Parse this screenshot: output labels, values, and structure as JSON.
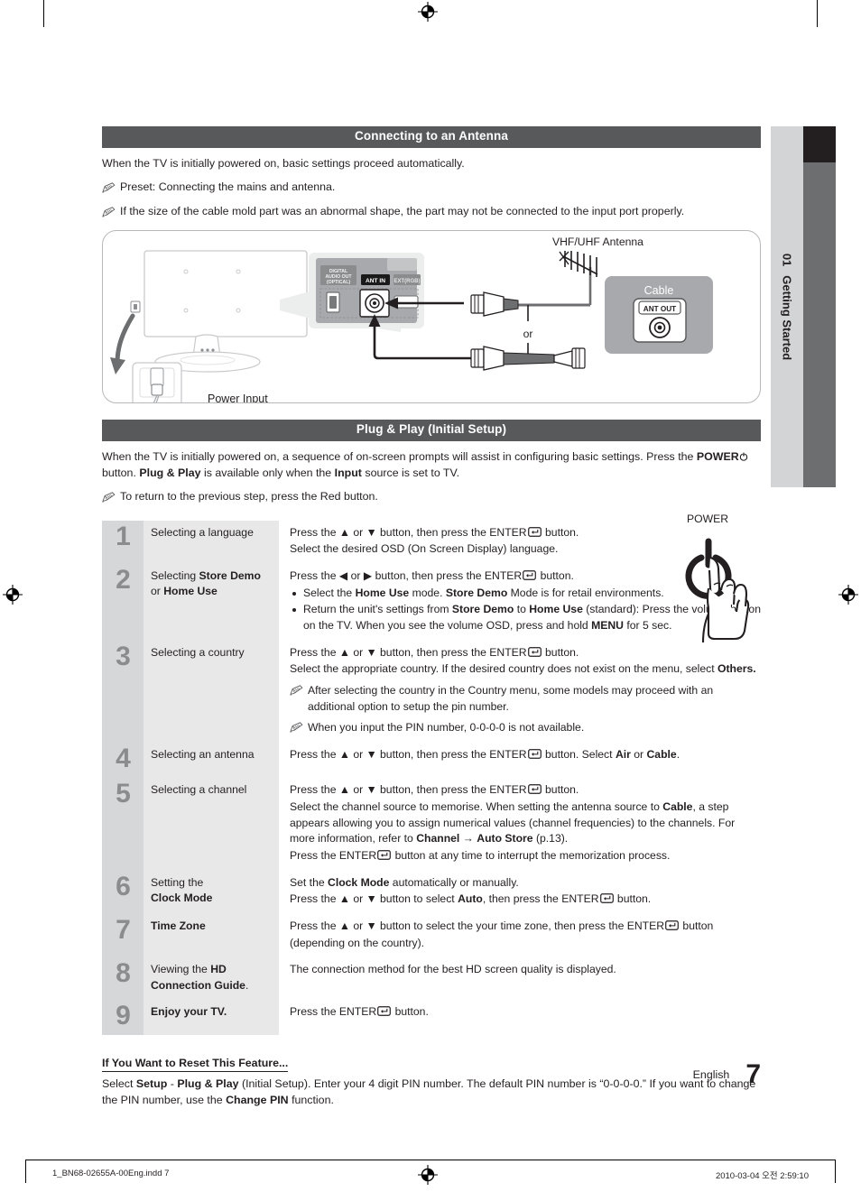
{
  "chapter_tab": {
    "number": "01",
    "title": "Getting Started"
  },
  "section_antenna": {
    "heading": "Connecting to an Antenna",
    "intro": "When the TV is initially powered on, basic settings proceed automatically.",
    "notes": [
      "Preset: Connecting the mains and antenna.",
      "If the size of the cable mold part was an abnormal shape, the part may not be connected to the input port properly."
    ],
    "diagram": {
      "power_input_label": "Power Input",
      "vhf_uhf_label": "VHF/UHF Antenna",
      "cable_box_label": "Cable",
      "ant_out_label": "ANT OUT",
      "ant_in_label": "ANT IN",
      "digital_audio_out_label": "DIGITAL AUDIO OUT (OPTICAL)",
      "ext_rgb_label": "EXT(RGB)",
      "or_label": "or"
    }
  },
  "section_plugplay": {
    "heading": "Plug & Play (Initial Setup)",
    "intro_1": "When the TV is initially powered on, a sequence of on-screen prompts will assist in configuring basic settings. Press the",
    "intro_power": "POWER",
    "intro_2": "button.",
    "intro_pp": "Plug & Play",
    "intro_3": "is available only when the",
    "intro_input": "Input",
    "intro_4": "source is set to TV.",
    "note": "To return to the previous step, press the Red button.",
    "power_art_label": "POWER"
  },
  "steps": [
    {
      "num": "1",
      "label_plain_1": "Selecting a language"
    },
    {
      "num": "2",
      "label_plain_1": "Selecting ",
      "label_bold_1": "Store Demo",
      "label_plain_2": "or ",
      "label_bold_2": "Home Use"
    },
    {
      "num": "3",
      "label_plain_1": "Selecting a country"
    },
    {
      "num": "4",
      "label_plain_1": "Selecting an antenna"
    },
    {
      "num": "5",
      "label_plain_1": "Selecting a channel"
    },
    {
      "num": "6",
      "label_plain_1": "Setting the",
      "label_bold_1": "Clock Mode"
    },
    {
      "num": "7",
      "label_bold_1": "Time Zone"
    },
    {
      "num": "8",
      "label_plain_1": "Viewing the ",
      "label_bold_1": "HD",
      "label_bold_2": "Connection Guide",
      "label_plain_2": "."
    },
    {
      "num": "9",
      "label_bold_1": "Enjoy your TV."
    }
  ],
  "step_text": {
    "s1_l1_a": "Press the ",
    "s1_l1_b": " or ",
    "s1_l1_c": " button, then press the ENTER",
    "s1_l1_d": " button.",
    "s1_l2": "Select the desired OSD (On Screen Display) language.",
    "s2_l1_a": "Press the ",
    "s2_l1_b": " or ",
    "s2_l1_c": " button, then press the ENTER",
    "s2_l1_d": " button.",
    "s2_b1_a": "Select the ",
    "s2_b1_bold1": "Home Use",
    "s2_b1_b": " mode. ",
    "s2_b1_bold2": "Store Demo",
    "s2_b1_c": " Mode is for retail environments.",
    "s2_b2_a": "Return the unit's settings from ",
    "s2_b2_bold1": "Store Demo",
    "s2_b2_b": " to ",
    "s2_b2_bold2": "Home Use",
    "s2_b2_c": " (standard): Press the volume button on the TV. When you see the volume OSD, press and hold ",
    "s2_b2_bold3": "MENU",
    "s2_b2_d": " for 5 sec.",
    "s3_l1_a": "Press the ",
    "s3_l1_b": " or ",
    "s3_l1_c": " button, then press the ENTER",
    "s3_l1_d": " button.",
    "s3_l2_a": "Select the appropriate country. If the desired country does not exist on the menu, select ",
    "s3_l2_bold": "Others.",
    "s3_n1": "After selecting the country in the Country menu, some models may proceed with an additional option to setup the pin number.",
    "s3_n2": "When you input the PIN number, 0-0-0-0 is not available.",
    "s4_l1_a": "Press the ",
    "s4_l1_b": " or ",
    "s4_l1_c": " button, then press the ENTER",
    "s4_l1_d": " button. Select ",
    "s4_l1_bold1": "Air",
    "s4_l1_e": " or ",
    "s4_l1_bold2": "Cable",
    "s4_l1_f": ".",
    "s5_l1_a": "Press the ",
    "s5_l1_b": " or ",
    "s5_l1_c": " button, then press the ENTER",
    "s5_l1_d": " button.",
    "s5_l2_a": "Select the channel source to memorise. When setting the antenna source to ",
    "s5_l2_bold1": "Cable",
    "s5_l2_b": ", a step appears allowing you to assign numerical values (channel frequencies) to the channels. For more information, refer to ",
    "s5_l2_bold2": "Channel",
    "s5_l2_arrow": " → ",
    "s5_l2_bold3": "Auto Store",
    "s5_l2_c": " (p.13).",
    "s5_l3_a": "Press the ENTER",
    "s5_l3_b": " button at any time to interrupt the memorization process.",
    "s6_l1_a": "Set the ",
    "s6_l1_bold": "Clock Mode",
    "s6_l1_b": " automatically or manually.",
    "s6_l2_a": "Press the ",
    "s6_l2_b": " or ",
    "s6_l2_c": " button to select ",
    "s6_l2_bold": "Auto",
    "s6_l2_d": ", then press the ENTER",
    "s6_l2_e": " button.",
    "s7_l1_a": "Press the ",
    "s7_l1_b": " or ",
    "s7_l1_c": " button to select the your time zone, then press the ENTER",
    "s7_l1_d": " button",
    "s7_l2": "(depending on the country).",
    "s8_l1": "The connection method for the best HD screen quality is displayed.",
    "s9_l1_a": "Press the ENTER",
    "s9_l1_b": " button."
  },
  "reset_block": {
    "title": "If You Want to Reset This Feature...",
    "body_a": "Select ",
    "body_bold1": "Setup",
    "body_b": " - ",
    "body_bold2": "Plug & Play",
    "body_c": " (Initial Setup). Enter your 4 digit PIN number. The default PIN number is “0-0-0-0.” If you want to change the PIN number, use the ",
    "body_bold3": "Change PIN",
    "body_d": " function."
  },
  "page_footer": {
    "language": "English",
    "page_number": "7"
  },
  "print_slug": {
    "left": "1_BN68-02655A-00Eng.indd   7",
    "right": "2010-03-04   오전 2:59:10"
  },
  "colors": {
    "band": "#58595b",
    "num_cell": "#d6d7d8",
    "label_cell": "#e8e8e9",
    "tab_light": "#d3d4d5",
    "tab_dark": "#231f20",
    "tab_gray": "#6d6e70",
    "text": "#231f20"
  }
}
